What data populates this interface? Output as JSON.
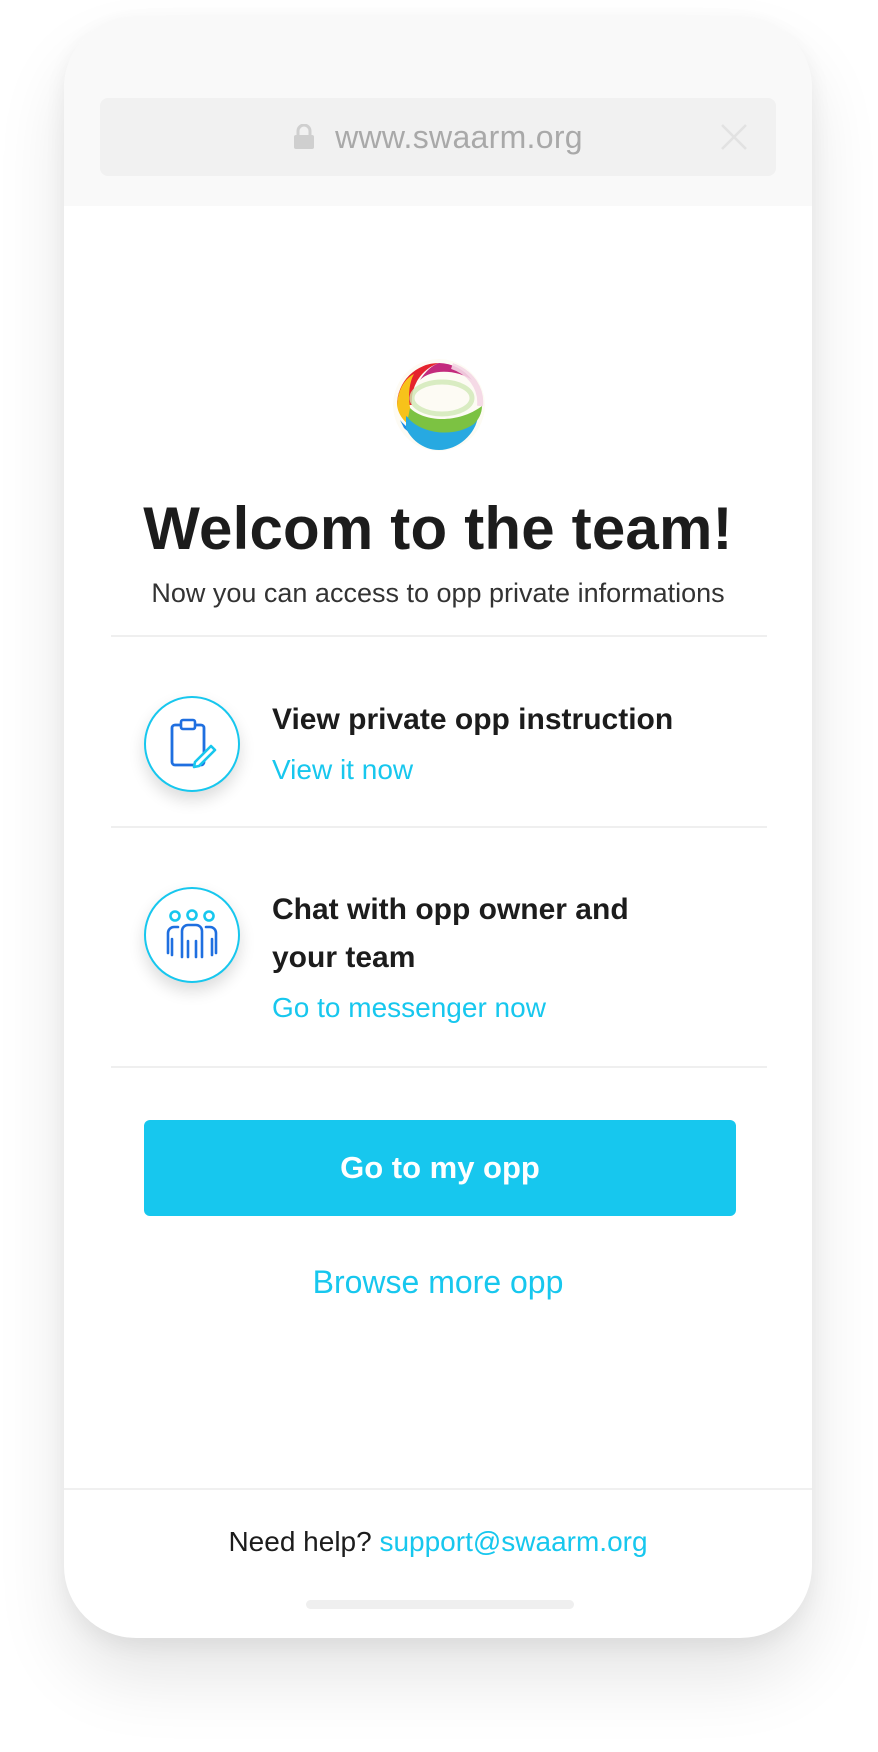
{
  "browser": {
    "url": "www.swaarm.org",
    "lock_icon": "lock-icon",
    "close_icon": "close-icon"
  },
  "header": {
    "logo": "swaarm-logo",
    "title": "Welcom to the team!",
    "subtitle": "Now you can access to opp private informations"
  },
  "features": [
    {
      "icon": "clipboard-edit-icon",
      "title": "View private opp instruction",
      "link": "View it now"
    },
    {
      "icon": "team-icon",
      "title_line1": "Chat with opp owner and",
      "title_line2": "your team",
      "link": "Go to messenger now"
    }
  ],
  "actions": {
    "primary": "Go to my opp",
    "secondary": "Browse more opp"
  },
  "footer": {
    "help_text": "Need help?",
    "support_email": "support@swaarm.org"
  },
  "colors": {
    "accent": "#17c7ee",
    "text": "#1c1c1c",
    "muted": "#a9a9a9"
  }
}
